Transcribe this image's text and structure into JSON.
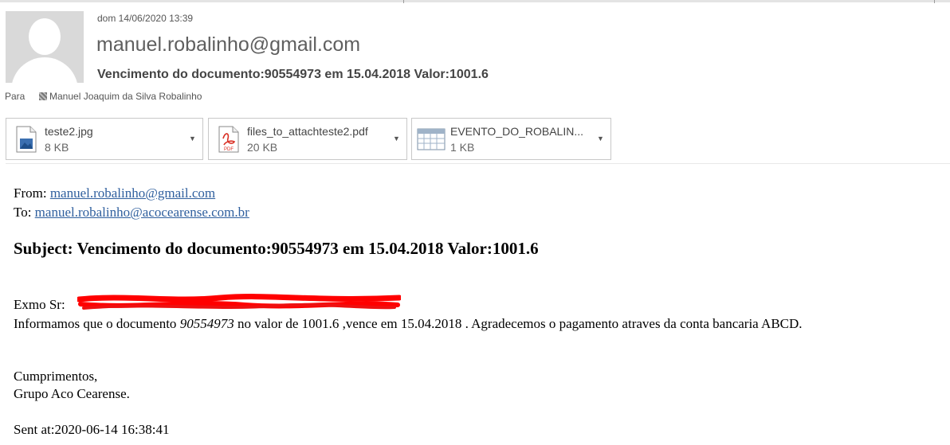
{
  "header": {
    "date": "dom 14/06/2020 13:39",
    "from": "manuel.robalinho@gmail.com",
    "subject": "Vencimento do documento:90554973 em 15.04.2018  Valor:1001.6",
    "to_label": "Para",
    "to_name": "Manuel Joaquim da Silva Robalinho"
  },
  "attachments": [
    {
      "name": "teste2.jpg",
      "size": "8 KB",
      "icon": "image-file-icon"
    },
    {
      "name": "files_to_attachteste2.pdf",
      "size": "20 KB",
      "icon": "pdf-file-icon"
    },
    {
      "name": "EVENTO_DO_ROBALIN...",
      "size": "1 KB",
      "icon": "calendar-file-icon"
    }
  ],
  "pdf_icon_text": "PDF",
  "body": {
    "from_label": "From: ",
    "from_email": "manuel.robalinho@gmail.com",
    "to_label": "To: ",
    "to_email": "manuel.robalinho@acocearense.com.br",
    "subject_line": "Subject: Vencimento do documento:90554973 em 15.04.2018 Valor:1001.6",
    "greeting": "Exmo Sr: ",
    "para_prefix": "Informamos que o documento ",
    "doc_number": "90554973",
    "para_suffix": " no valor de 1001.6 ,vence em 15.04.2018 . Agradecemos o pagamento atraves da conta bancaria ABCD.",
    "closing": "Cumprimentos,",
    "signature": "Grupo Aco Cearense.",
    "sent_at": "Sent at:2020-06-14 16:38:41"
  },
  "colors": {
    "link": "#2f5f9e",
    "redaction": "#ff0000",
    "pdf_red": "#d93025"
  }
}
